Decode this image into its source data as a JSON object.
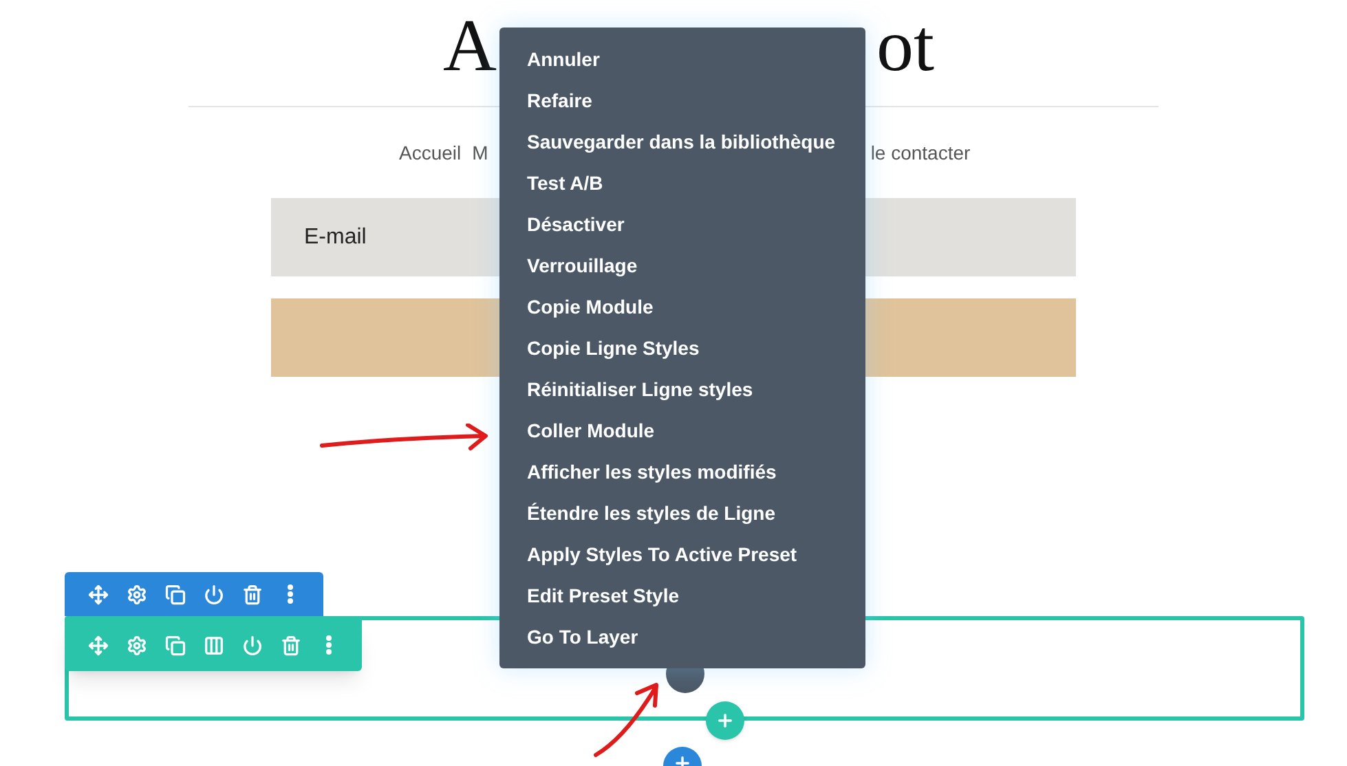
{
  "site_title": {
    "left": "A",
    "right": "ot"
  },
  "nav": [
    "Accueil",
    "M",
    "le contacter"
  ],
  "email_field": {
    "placeholder": "E-mail"
  },
  "context_menu": [
    "Annuler",
    "Refaire",
    "Sauvegarder dans la bibliothèque",
    "Test A/B",
    "Désactiver",
    "Verrouillage",
    "Copie Module",
    "Copie Ligne Styles",
    "Réinitialiser Ligne styles",
    "Coller Module",
    "Afficher les styles modifiés",
    "Étendre les styles de Ligne",
    "Apply Styles To Active Preset",
    "Edit Preset Style",
    "Go To Layer"
  ]
}
